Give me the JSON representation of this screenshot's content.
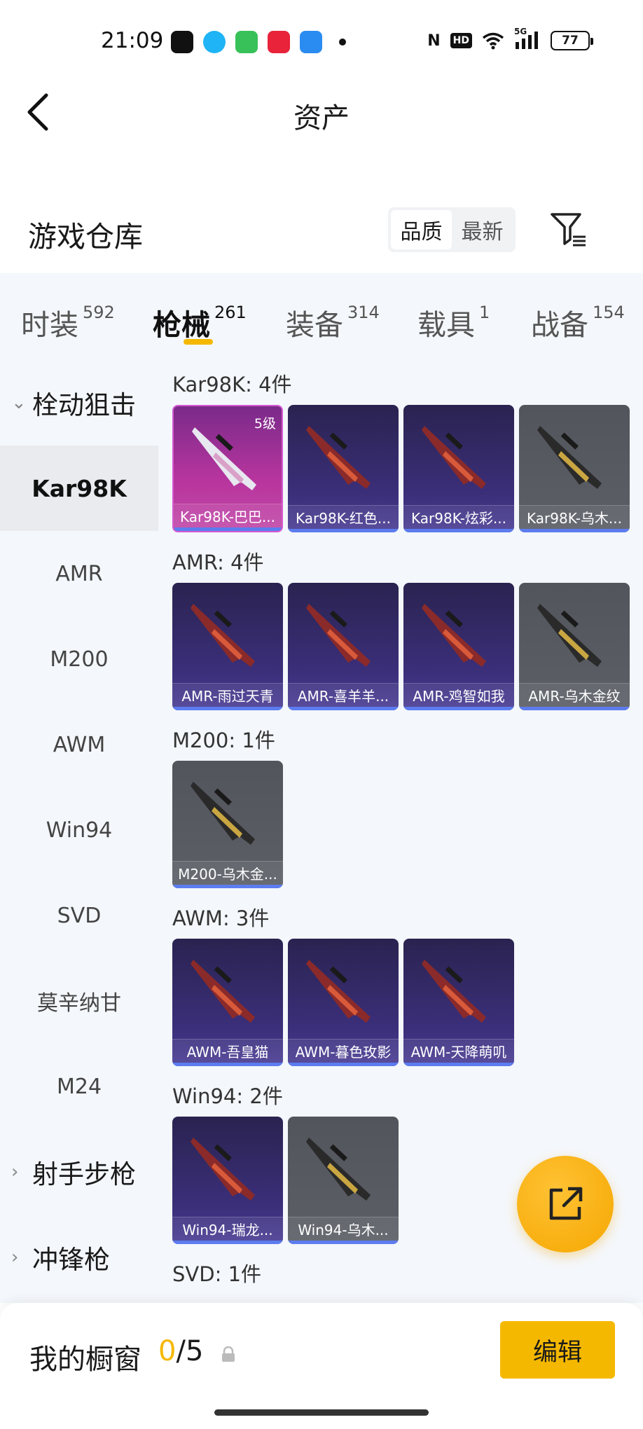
{
  "status_bar": {
    "time": "21:09",
    "battery": "77",
    "signal_label": "5G",
    "hd_label": "HD",
    "nfc_label": "N"
  },
  "nav": {
    "title": "资产"
  },
  "header": {
    "title": "游戏仓库",
    "sort_options": [
      "品质",
      "最新"
    ],
    "active_sort": "品质"
  },
  "categories": [
    {
      "label": "时装",
      "count": "592",
      "active": false
    },
    {
      "label": "枪械",
      "count": "261",
      "active": true
    },
    {
      "label": "装备",
      "count": "314",
      "active": false
    },
    {
      "label": "载具",
      "count": "1",
      "active": false
    },
    {
      "label": "战备",
      "count": "154",
      "active": false
    }
  ],
  "sidebar": {
    "groups": [
      {
        "label": "栓动狙击",
        "expanded": true
      },
      {
        "label": "射手步枪",
        "expanded": false
      },
      {
        "label": "冲锋枪",
        "expanded": false
      }
    ],
    "items": [
      "Kar98K",
      "AMR",
      "M200",
      "AWM",
      "Win94",
      "SVD",
      "莫辛纳甘",
      "M24"
    ],
    "active_item": "Kar98K"
  },
  "groups": [
    {
      "title": "Kar98K: 4件",
      "items": [
        {
          "label": "Kar98K-巴巴...",
          "rarity": "pink",
          "badge": "5级"
        },
        {
          "label": "Kar98K-红色...",
          "rarity": "purple"
        },
        {
          "label": "Kar98K-炫彩...",
          "rarity": "purple"
        },
        {
          "label": "Kar98K-乌木...",
          "rarity": "gray"
        }
      ]
    },
    {
      "title": "AMR: 4件",
      "items": [
        {
          "label": "AMR-雨过天青",
          "rarity": "purple"
        },
        {
          "label": "AMR-喜羊羊...",
          "rarity": "purple"
        },
        {
          "label": "AMR-鸡智如我",
          "rarity": "purple"
        },
        {
          "label": "AMR-乌木金纹",
          "rarity": "gray"
        }
      ]
    },
    {
      "title": "M200: 1件",
      "items": [
        {
          "label": "M200-乌木金...",
          "rarity": "gray"
        }
      ]
    },
    {
      "title": "AWM: 3件",
      "items": [
        {
          "label": "AWM-吾皇猫",
          "rarity": "purple"
        },
        {
          "label": "AWM-暮色玫影",
          "rarity": "purple"
        },
        {
          "label": "AWM-天降萌叽",
          "rarity": "purple"
        }
      ]
    },
    {
      "title": "Win94: 2件",
      "items": [
        {
          "label": "Win94-瑞龙...",
          "rarity": "purple"
        },
        {
          "label": "Win94-乌木...",
          "rarity": "gray"
        }
      ]
    },
    {
      "title": "SVD: 1件",
      "items": []
    }
  ],
  "bottom": {
    "showcase_label": "我的橱窗",
    "current": "0",
    "separator": "/",
    "max": "5",
    "edit_label": "编辑"
  },
  "colors": {
    "accent": "#f5b800",
    "tab_bg": "#f4f7fb",
    "card_purple": "#3b2f7a",
    "card_pink": "#b8359e",
    "card_gray": "#5c5f66"
  }
}
